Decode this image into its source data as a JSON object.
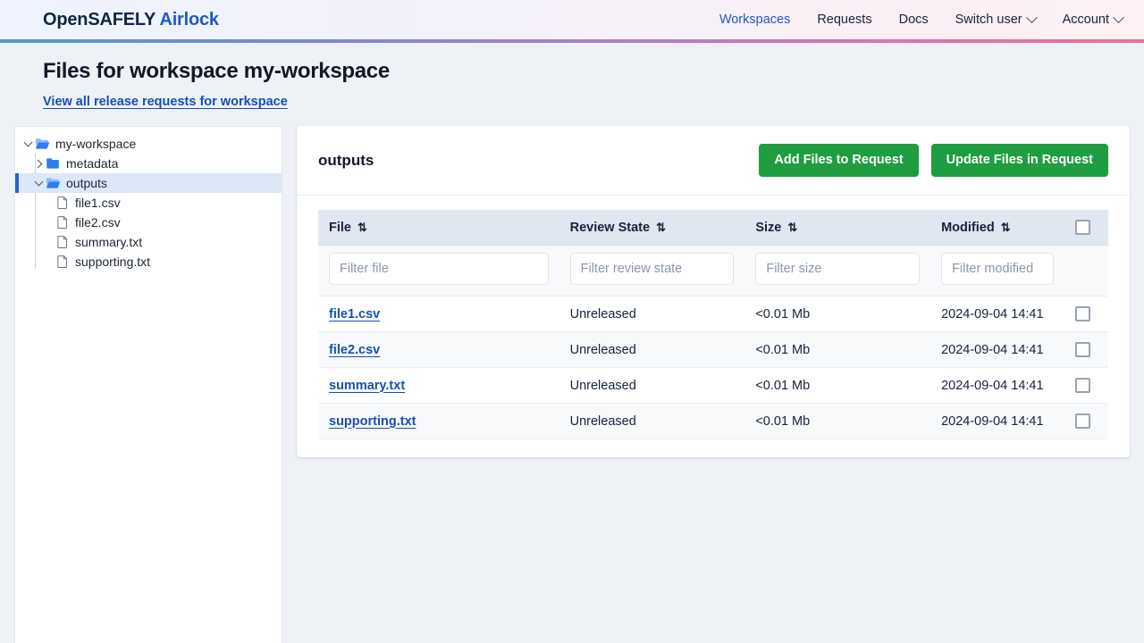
{
  "navbar": {
    "brand_main": "OpenSAFELY",
    "brand_accent": "Airlock",
    "links": [
      {
        "label": "Workspaces",
        "active": true,
        "dropdown": false
      },
      {
        "label": "Requests",
        "active": false,
        "dropdown": false
      },
      {
        "label": "Docs",
        "active": false,
        "dropdown": false
      },
      {
        "label": "Switch user",
        "active": false,
        "dropdown": true
      },
      {
        "label": "Account",
        "active": false,
        "dropdown": true
      }
    ]
  },
  "page": {
    "title": "Files for workspace my-workspace",
    "sublink": "View all release requests for workspace"
  },
  "tree": {
    "root": {
      "label": "my-workspace",
      "icon": "folder-open-icon",
      "expanded": true
    },
    "metadata": {
      "label": "metadata",
      "icon": "folder-closed-icon",
      "expanded": false
    },
    "outputs": {
      "label": "outputs",
      "icon": "folder-open-icon",
      "expanded": true,
      "selected": true
    },
    "files": [
      {
        "label": "file1.csv",
        "icon": "file-icon"
      },
      {
        "label": "file2.csv",
        "icon": "file-icon"
      },
      {
        "label": "summary.txt",
        "icon": "file-icon"
      },
      {
        "label": "supporting.txt",
        "icon": "file-icon"
      }
    ]
  },
  "card": {
    "title": "outputs",
    "add_button": "Add Files to Request",
    "update_button": "Update Files in Request"
  },
  "table": {
    "columns": [
      {
        "label": "File",
        "sort_icon": "⇅"
      },
      {
        "label": "Review State",
        "sort_icon": "⇅"
      },
      {
        "label": "Size",
        "sort_icon": "⇅"
      },
      {
        "label": "Modified",
        "sort_icon": "⇅"
      }
    ],
    "filters": [
      {
        "placeholder": "Filter file"
      },
      {
        "placeholder": "Filter review state"
      },
      {
        "placeholder": "Filter size"
      },
      {
        "placeholder": "Filter modified"
      }
    ],
    "rows": [
      {
        "file": "file1.csv",
        "review_state": "Unreleased",
        "size": "<0.01 Mb",
        "modified": "2024-09-04 14:41",
        "checked": false
      },
      {
        "file": "file2.csv",
        "review_state": "Unreleased",
        "size": "<0.01 Mb",
        "modified": "2024-09-04 14:41",
        "checked": false
      },
      {
        "file": "summary.txt",
        "review_state": "Unreleased",
        "size": "<0.01 Mb",
        "modified": "2024-09-04 14:41",
        "checked": false
      },
      {
        "file": "supporting.txt",
        "review_state": "Unreleased",
        "size": "<0.01 Mb",
        "modified": "2024-09-04 14:41",
        "checked": false
      }
    ]
  },
  "colors": {
    "brand_accent": "#1f5bc4",
    "link": "#1550b5",
    "button_green": "#1f9d41",
    "page_background": "#eef1f6",
    "table_header": "#e1e7f0",
    "tree_selected": "#dce8f8",
    "tree_selected_bar": "#2b5fc4",
    "folder_icon": "#2f7bef"
  }
}
